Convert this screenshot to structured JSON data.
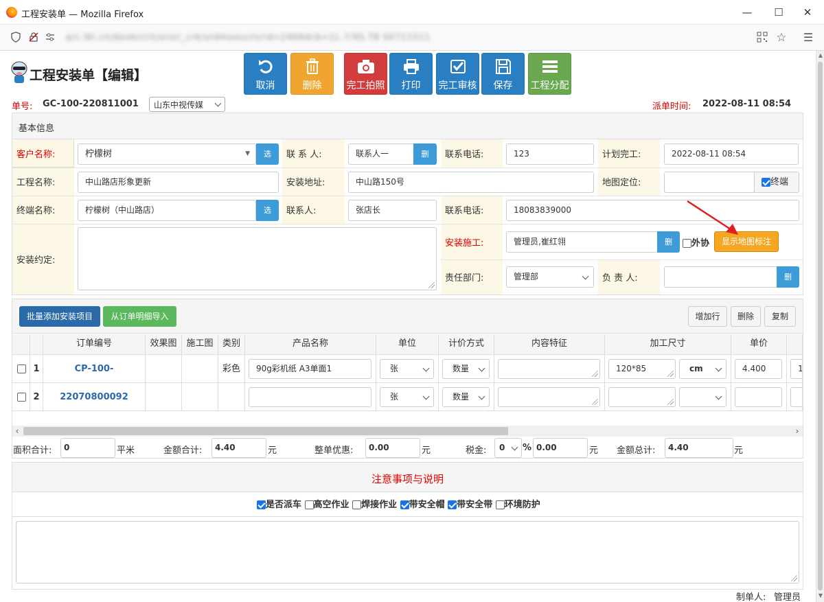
{
  "window": {
    "title": "工程安装单 — Mozilla Firefox",
    "url": "a/c.lbl.cn/dovb/crit/orsir_crk/ordmoouctv/id=2466dcb=1L.7/9S.T8 00711511"
  },
  "header": {
    "title": "工程安装单【编辑】"
  },
  "toolbar": [
    {
      "label": "取消",
      "icon": "undo-icon",
      "color": "#2a7fc3"
    },
    {
      "label": "删除",
      "icon": "trash-icon",
      "color": "#f0a530"
    },
    {
      "label": "完工拍照",
      "icon": "camera-icon",
      "color": "#d23c3c"
    },
    {
      "label": "打印",
      "icon": "printer-icon",
      "color": "#2a7fc3"
    },
    {
      "label": "完工审核",
      "icon": "check-square-icon",
      "color": "#2a7fc3"
    },
    {
      "label": "保存",
      "icon": "save-icon",
      "color": "#2a7fc3"
    },
    {
      "label": "工程分配",
      "icon": "list-icon",
      "color": "#6aa84f"
    }
  ],
  "order": {
    "no_label": "单号:",
    "no_value": "GC-100-220811001",
    "company": "山东中视传媒",
    "dispatch_label": "派单时间:",
    "dispatch_value": "2022-08-11 08:54"
  },
  "basic": {
    "section_title": "基本信息",
    "customer_label": "客户名称:",
    "customer_value": "柠檬树",
    "pick_btn": "选",
    "contact_label": "联 系 人:",
    "contact_value": "联系人一",
    "del_btn": "删",
    "phone_label": "联系电话:",
    "phone_value": "123",
    "plan_label": "计划完工:",
    "plan_value": "2022-08-11 08:54",
    "project_label": "工程名称:",
    "project_value": "中山路店形象更新",
    "address_label": "安装地址:",
    "address_value": "中山路150号",
    "map_label": "地图定位:",
    "map_value": "",
    "terminal_chk": "终端",
    "terminal_label": "终端名称:",
    "terminal_value": "柠檬树（中山路店）",
    "contact2_label": "联系人:",
    "contact2_value": "张店长",
    "phone2_label": "联系电话:",
    "phone2_value": "18083839000",
    "agreement_label": "安装约定:",
    "agreement_value": "",
    "install_label": "安装施工:",
    "install_value": "管理员,崔红翎",
    "outsource_chk": "外协",
    "map_btn": "显示地图标注",
    "dept_label": "责任部门:",
    "dept_value": "管理部",
    "owner_label": "负 责 人:",
    "owner_value": ""
  },
  "items": {
    "batch_btn": "批量添加安装项目",
    "import_btn": "从订单明细导入",
    "add_row_btn": "增加行",
    "del_row_btn": "删除",
    "copy_btn": "复制",
    "headers": [
      "订单编号",
      "效果图",
      "施工图",
      "类别",
      "产品名称",
      "单位",
      "计价方式",
      "内容特征",
      "加工尺寸",
      "单价"
    ],
    "rows": [
      {
        "no": "1",
        "order": "CP-100-22070800092",
        "category": "彩色",
        "product": "90g彩机纸 A3单面1",
        "unit": "张",
        "pricing": "数量",
        "feature": "",
        "size": "120*85",
        "size_unit": "cm",
        "price": "4.400",
        "extra": "1"
      },
      {
        "no": "2",
        "order": "",
        "category": "",
        "product": "",
        "unit": "张",
        "pricing": "数量",
        "feature": "",
        "size": "",
        "size_unit": "",
        "price": "",
        "extra": ""
      }
    ]
  },
  "totals": {
    "area_label": "面积合计:",
    "area_value": "0",
    "area_unit": "平米",
    "amount_label": "金额合计:",
    "amount_value": "4.40",
    "amount_unit": "元",
    "discount_label": "整单优惠:",
    "discount_value": "0.00",
    "discount_unit": "元",
    "tax_label": "税金:",
    "tax_rate": "0",
    "tax_pct": "%",
    "tax_value": "0.00",
    "tax_unit": "元",
    "total_label": "金额总计:",
    "total_value": "4.40",
    "total_unit": "元"
  },
  "notes": {
    "title": "注意事项与说明",
    "options": [
      {
        "label": "是否派车",
        "checked": true
      },
      {
        "label": "高空作业",
        "checked": false
      },
      {
        "label": "焊接作业",
        "checked": false
      },
      {
        "label": "带安全帽",
        "checked": true
      },
      {
        "label": "带安全带",
        "checked": true
      },
      {
        "label": "环境防护",
        "checked": false
      }
    ],
    "text": ""
  },
  "footer": {
    "maker_label": "制单人:",
    "maker_value": "管理员"
  },
  "colors": {
    "primary": "#2a7fc3",
    "danger": "#d23c3c",
    "warning": "#f0a530",
    "success": "#6aa84f",
    "label_bg": "#fdf8e6"
  }
}
